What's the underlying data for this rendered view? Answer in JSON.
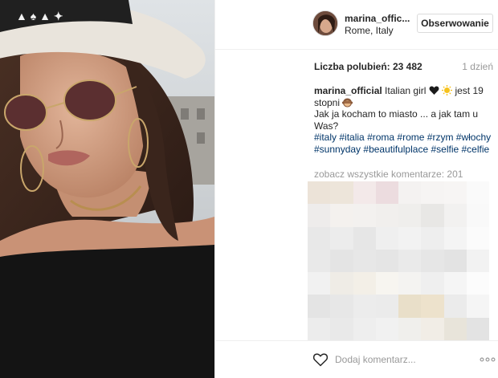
{
  "post": {
    "username": "marina_offic...",
    "location": "Rome, Italy",
    "follow_label": "Obserwowanie",
    "likes": "Liczba polubień: 23 482",
    "time": "1 dzień"
  },
  "caption": {
    "user": "marina_official",
    "text_part1": "Italian girl",
    "text_part2": "jest 19 stopni",
    "text_line2": "Jak ja kocham to miasto ... a jak tam u Was?",
    "hashtags": [
      "#italy",
      "#italia",
      "#roma",
      "#rome",
      "#rzym",
      "#włochy",
      "#sunnyday",
      "#beautifulplace",
      "#selfie",
      "#celfie"
    ]
  },
  "comments": {
    "view_all": "zobacz wszystkie komentarze: 201"
  },
  "footer": {
    "comment_placeholder": "Dodaj komentarz..."
  },
  "icons": {
    "heart": "heart-icon",
    "more": "more-options-icon",
    "black_heart": "black-heart-emoji",
    "sun": "sun-emoji",
    "monkey": "see-no-evil-monkey-emoji"
  },
  "colors": {
    "hashtag": "#003569",
    "muted": "#999999",
    "text": "#262626",
    "border": "#dbdbdb"
  }
}
